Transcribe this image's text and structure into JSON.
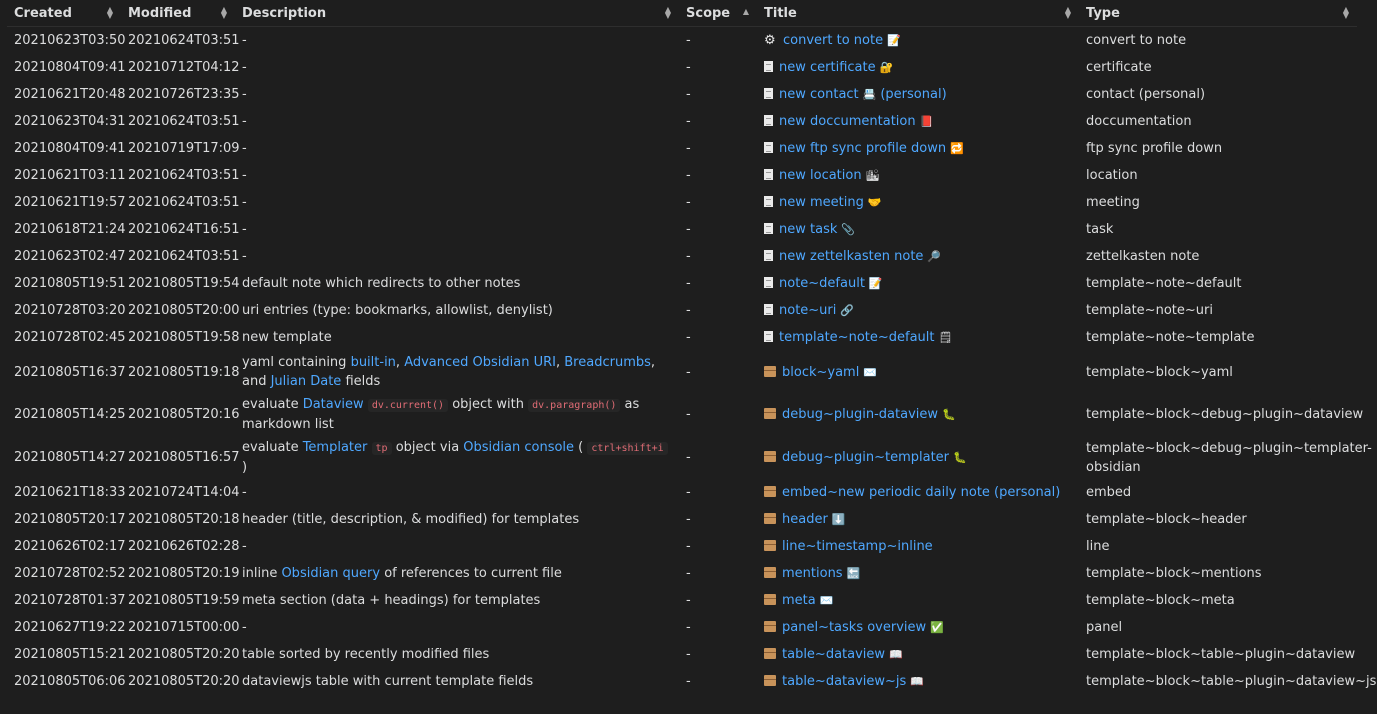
{
  "headers": [
    "Created",
    "Modified",
    "Description",
    "Scope",
    "Title",
    "Type"
  ],
  "rows": [
    {
      "created": "20210623T03:50",
      "modified": "20210624T03:51",
      "desc": [
        {
          "t": "-"
        }
      ],
      "scope": "-",
      "icon": "gear-icon",
      "title": "convert to note",
      "emoji": "📝",
      "type": "convert to note"
    },
    {
      "created": "20210804T09:41",
      "modified": "20210712T04:12",
      "desc": [
        {
          "t": "-"
        }
      ],
      "scope": "-",
      "icon": "document-icon",
      "title": "new certificate",
      "emoji": "🔐",
      "type": "certificate"
    },
    {
      "created": "20210621T20:48",
      "modified": "20210726T23:35",
      "desc": [
        {
          "t": "-"
        }
      ],
      "scope": "-",
      "icon": "document-icon",
      "title": "new contact",
      "emoji": "📇",
      "title2": "(personal)",
      "type": "contact (personal)"
    },
    {
      "created": "20210623T04:31",
      "modified": "20210624T03:51",
      "desc": [
        {
          "t": "-"
        }
      ],
      "scope": "-",
      "icon": "document-icon",
      "title": "new doccumentation",
      "emoji": "📕",
      "type": "doccumentation"
    },
    {
      "created": "20210804T09:41",
      "modified": "20210719T17:09",
      "desc": [
        {
          "t": "-"
        }
      ],
      "scope": "-",
      "icon": "document-icon",
      "title": "new ftp sync profile down",
      "emoji": "🔁",
      "type": "ftp sync profile down"
    },
    {
      "created": "20210621T03:11",
      "modified": "20210624T03:51",
      "desc": [
        {
          "t": "-"
        }
      ],
      "scope": "-",
      "icon": "document-icon",
      "title": "new location",
      "emoji": "🏙",
      "type": "location"
    },
    {
      "created": "20210621T19:57",
      "modified": "20210624T03:51",
      "desc": [
        {
          "t": "-"
        }
      ],
      "scope": "-",
      "icon": "document-icon",
      "title": "new meeting",
      "emoji": "🤝",
      "type": "meeting"
    },
    {
      "created": "20210618T21:24",
      "modified": "20210624T16:51",
      "desc": [
        {
          "t": "-"
        }
      ],
      "scope": "-",
      "icon": "document-icon",
      "title": "new task",
      "emoji": "📎",
      "type": "task"
    },
    {
      "created": "20210623T02:47",
      "modified": "20210624T03:51",
      "desc": [
        {
          "t": "-"
        }
      ],
      "scope": "-",
      "icon": "document-icon",
      "title": "new zettelkasten note",
      "emoji": "🔎",
      "type": "zettelkasten note"
    },
    {
      "created": "20210805T19:51",
      "modified": "20210805T19:54",
      "desc": [
        {
          "t": "default note which redirects to other notes"
        }
      ],
      "scope": "-",
      "icon": "document-icon",
      "title": "note~default",
      "emoji": "📝",
      "type": "template~note~default"
    },
    {
      "created": "20210728T03:20",
      "modified": "20210805T20:00",
      "desc": [
        {
          "t": "uri entries (type: bookmarks, allowlist, denylist)"
        }
      ],
      "scope": "-",
      "icon": "document-icon",
      "title": "note~uri",
      "emoji": "🔗",
      "type": "template~note~uri"
    },
    {
      "created": "20210728T02:45",
      "modified": "20210805T19:58",
      "desc": [
        {
          "t": "new template"
        }
      ],
      "scope": "-",
      "icon": "document-icon",
      "title": "template~note~default",
      "emoji": "🗒",
      "type": "template~note~template"
    },
    {
      "created": "20210805T16:37",
      "modified": "20210805T19:18",
      "desc": [
        {
          "t": "yaml containing "
        },
        {
          "t": "built-in",
          "k": "link"
        },
        {
          "t": ", "
        },
        {
          "t": "Advanced Obsidian URI",
          "k": "link"
        },
        {
          "t": ", "
        },
        {
          "t": "Breadcrumbs",
          "k": "link"
        },
        {
          "t": ", and "
        },
        {
          "t": "Julian Date",
          "k": "link"
        },
        {
          "t": " fields"
        }
      ],
      "scope": "-",
      "icon": "box-icon",
      "title": "block~yaml",
      "emoji": "✉️",
      "type": "template~block~yaml"
    },
    {
      "created": "20210805T14:25",
      "modified": "20210805T20:16",
      "desc": [
        {
          "t": "evaluate "
        },
        {
          "t": "Dataview",
          "k": "link"
        },
        {
          "t": " "
        },
        {
          "t": "dv.current()",
          "k": "code"
        },
        {
          "t": " object with "
        },
        {
          "t": "dv.paragraph()",
          "k": "code"
        },
        {
          "t": " as markdown list"
        }
      ],
      "scope": "-",
      "icon": "box-icon",
      "title": "debug~plugin-dataview",
      "emoji": "🐛",
      "type": "template~block~debug~plugin~dataview"
    },
    {
      "created": "20210805T14:27",
      "modified": "20210805T16:57",
      "desc": [
        {
          "t": "evaluate "
        },
        {
          "t": "Templater",
          "k": "link"
        },
        {
          "t": " "
        },
        {
          "t": "tp",
          "k": "code"
        },
        {
          "t": " object via "
        },
        {
          "t": "Obsidian console",
          "k": "link"
        },
        {
          "t": " ( "
        },
        {
          "t": "ctrl+shift+i",
          "k": "code"
        },
        {
          "t": " )"
        }
      ],
      "scope": "-",
      "icon": "box-icon",
      "title": "debug~plugin~templater",
      "emoji": "🐛",
      "type": "template~block~debug~plugin~templater-obsidian"
    },
    {
      "created": "20210621T18:33",
      "modified": "20210724T14:04",
      "desc": [
        {
          "t": "-"
        }
      ],
      "scope": "-",
      "icon": "box-icon",
      "title": "embed~new periodic daily note (personal)",
      "emoji": "",
      "type": "embed"
    },
    {
      "created": "20210805T20:17",
      "modified": "20210805T20:18",
      "desc": [
        {
          "t": "header (title, description, & modified) for templates"
        }
      ],
      "scope": "-",
      "icon": "box-icon",
      "title": "header",
      "emoji": "⬇️",
      "type": "template~block~header"
    },
    {
      "created": "20210626T02:17",
      "modified": "20210626T02:28",
      "desc": [
        {
          "t": "-"
        }
      ],
      "scope": "-",
      "icon": "box-icon",
      "title": "line~timestamp~inline",
      "emoji": "",
      "type": "line"
    },
    {
      "created": "20210728T02:52",
      "modified": "20210805T20:19",
      "desc": [
        {
          "t": "inline "
        },
        {
          "t": "Obsidian query",
          "k": "link"
        },
        {
          "t": " of references to current file"
        }
      ],
      "scope": "-",
      "icon": "box-icon",
      "title": "mentions",
      "emoji": "🔙",
      "type": "template~block~mentions"
    },
    {
      "created": "20210728T01:37",
      "modified": "20210805T19:59",
      "desc": [
        {
          "t": "meta section (data + headings) for templates"
        }
      ],
      "scope": "-",
      "icon": "box-icon",
      "title": "meta",
      "emoji": "✉️",
      "type": "template~block~meta"
    },
    {
      "created": "20210627T19:22",
      "modified": "20210715T00:00",
      "desc": [
        {
          "t": "-"
        }
      ],
      "scope": "-",
      "icon": "box-icon",
      "title": "panel~tasks overview",
      "emoji": "✅",
      "type": "panel"
    },
    {
      "created": "20210805T15:21",
      "modified": "20210805T20:20",
      "desc": [
        {
          "t": "table sorted by recently modified files"
        }
      ],
      "scope": "-",
      "icon": "box-icon",
      "title": "table~dataview",
      "emoji": "📖",
      "type": "template~block~table~plugin~dataview"
    },
    {
      "created": "20210805T06:06",
      "modified": "20210805T20:20",
      "desc": [
        {
          "t": "dataviewjs table with current template fields"
        }
      ],
      "scope": "-",
      "icon": "box-icon",
      "title": "table~dataview~js",
      "emoji": "📖",
      "type": "template~block~table~plugin~dataview~js"
    }
  ]
}
